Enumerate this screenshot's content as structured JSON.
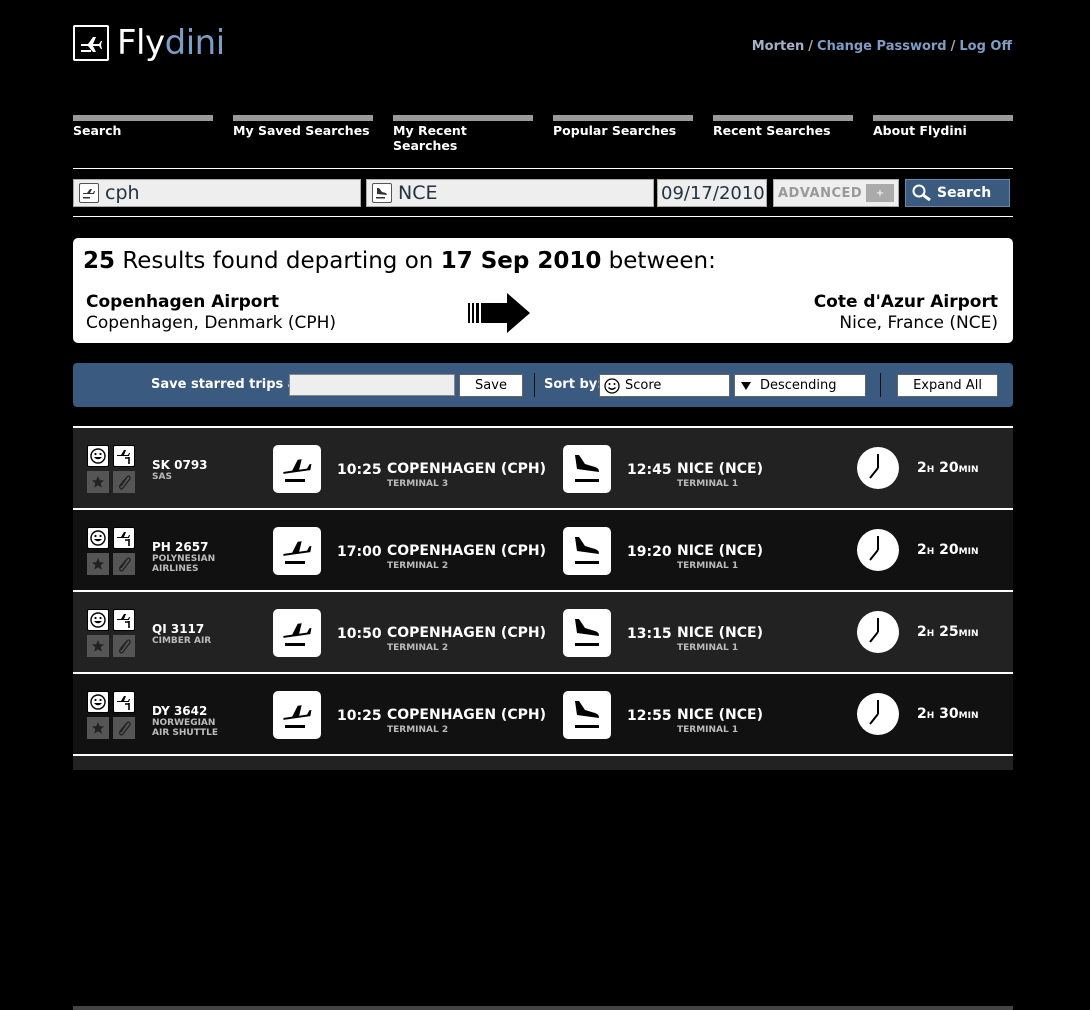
{
  "brand": {
    "part1": "Fly",
    "part2": "dini"
  },
  "userbar": {
    "user": "Morten",
    "sep": "/",
    "change_password": "Change Password",
    "logout": "Log Off"
  },
  "nav": [
    {
      "label": "Search"
    },
    {
      "label": "My Saved Searches"
    },
    {
      "label": "My Recent Searches"
    },
    {
      "label": "Popular Searches"
    },
    {
      "label": "Recent Searches"
    },
    {
      "label": "About Flydini"
    }
  ],
  "search": {
    "from_value": "cph",
    "to_value": "NCE",
    "date_value": "09/17/2010",
    "advanced_label": "ADVANCED",
    "advanced_icon": "+",
    "search_label": "Search"
  },
  "summary": {
    "count": "25",
    "text1": "Results found departing on",
    "date": "17 Sep 2010",
    "text2": "between:",
    "from_name": "Copenhagen Airport",
    "from_detail": "Copenhagen, Denmark (CPH)",
    "to_name": "Cote d'Azur Airport",
    "to_detail": "Nice, France (NCE)"
  },
  "toolbar": {
    "save_label": "Save starred trips as:",
    "save_value": "",
    "save_button": "Save",
    "sort_label": "Sort by:",
    "sort_value": "Score",
    "order_value": "Descending",
    "expand_label": "Expand All"
  },
  "flights": [
    {
      "flight_no": "SK 0793",
      "airline": "SAS",
      "airline2": "",
      "dep_time": "10:25",
      "dep_place": "COPENHAGEN (CPH)",
      "dep_terminal": "TERMINAL 3",
      "arr_time": "12:45",
      "arr_place": "NICE (NCE)",
      "arr_terminal": "TERMINAL 1",
      "dur_h": "2",
      "dur_m": "20"
    },
    {
      "flight_no": "PH 2657",
      "airline": "POLYNESIAN",
      "airline2": "AIRLINES",
      "dep_time": "17:00",
      "dep_place": "COPENHAGEN (CPH)",
      "dep_terminal": "TERMINAL 2",
      "arr_time": "19:20",
      "arr_place": "NICE (NCE)",
      "arr_terminal": "TERMINAL 1",
      "dur_h": "2",
      "dur_m": "20"
    },
    {
      "flight_no": "QI 3117",
      "airline": "CIMBER AIR",
      "airline2": "",
      "dep_time": "10:50",
      "dep_place": "COPENHAGEN (CPH)",
      "dep_terminal": "TERMINAL 2",
      "arr_time": "13:15",
      "arr_place": "NICE (NCE)",
      "arr_terminal": "TERMINAL 1",
      "dur_h": "2",
      "dur_m": "25"
    },
    {
      "flight_no": "DY 3642",
      "airline": "NORWEGIAN",
      "airline2": "AIR SHUTTLE",
      "dep_time": "10:25",
      "dep_place": "COPENHAGEN (CPH)",
      "dep_terminal": "TERMINAL 2",
      "arr_time": "12:55",
      "arr_place": "NICE (NCE)",
      "arr_terminal": "TERMINAL 1",
      "dur_h": "2",
      "dur_m": "30"
    }
  ],
  "units": {
    "hours": "H",
    "minutes": "MIN"
  },
  "colors": {
    "accent": "#3b5a80",
    "brand_blue": "#7f9cc4"
  }
}
